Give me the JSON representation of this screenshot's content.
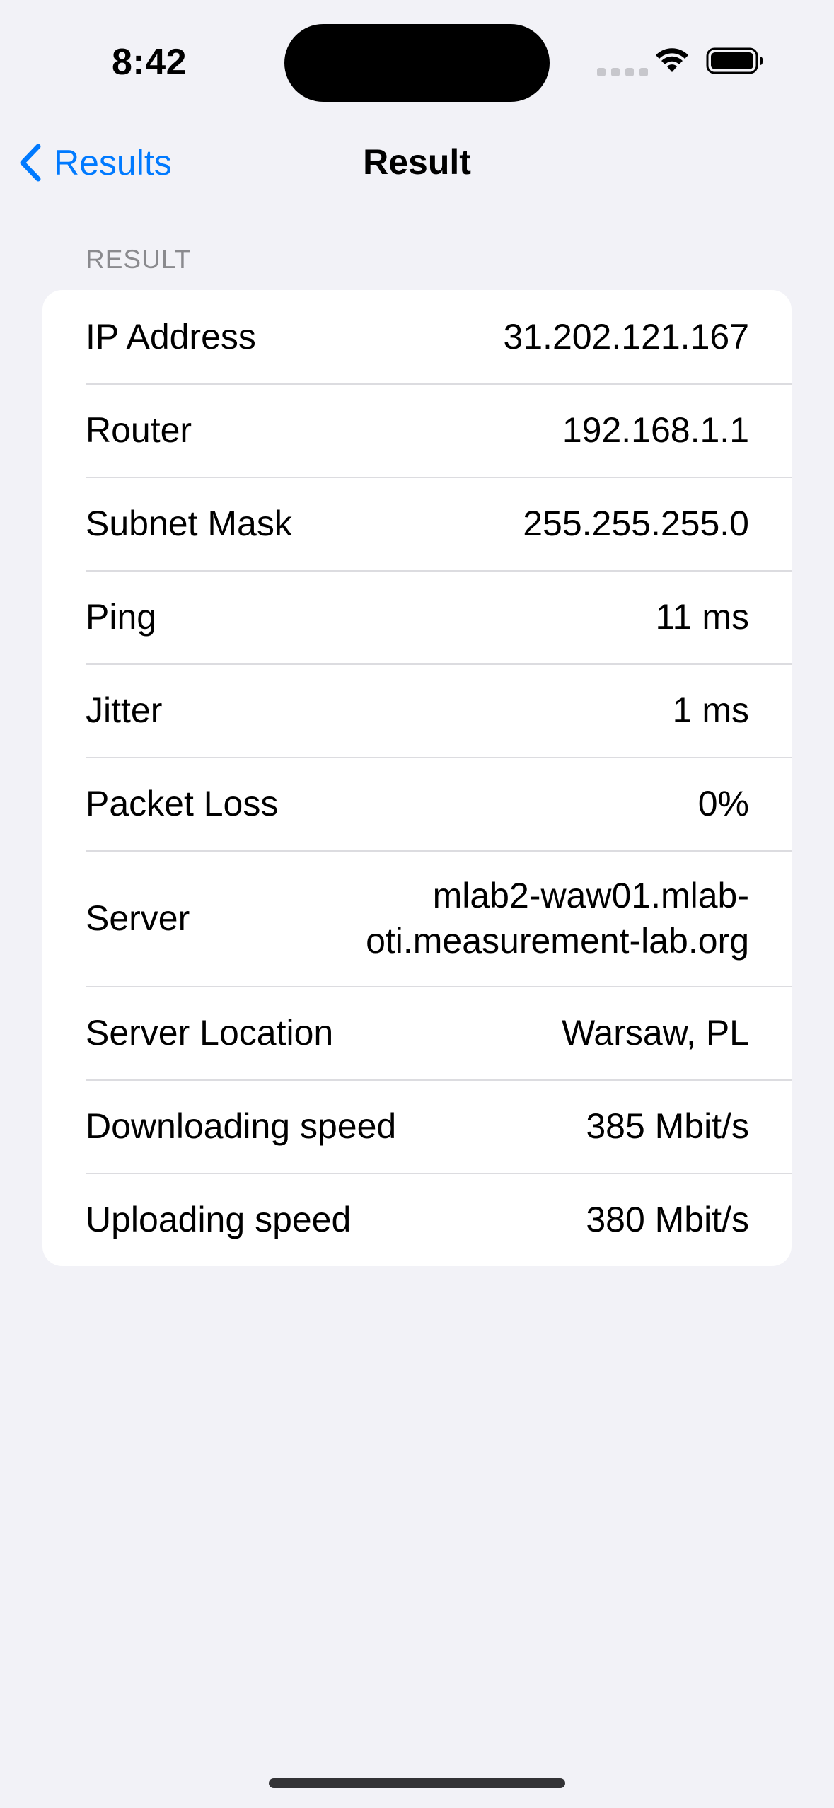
{
  "status_bar": {
    "time": "8:42"
  },
  "nav": {
    "back_label": "Results",
    "title": "Result"
  },
  "section": {
    "header": "RESULT"
  },
  "rows": [
    {
      "label": "IP Address",
      "value": "31.202.121.167"
    },
    {
      "label": "Router",
      "value": "192.168.1.1"
    },
    {
      "label": "Subnet Mask",
      "value": "255.255.255.0"
    },
    {
      "label": "Ping",
      "value": "11 ms"
    },
    {
      "label": "Jitter",
      "value": "1 ms"
    },
    {
      "label": "Packet Loss",
      "value": "0%"
    },
    {
      "label": "Server",
      "value": "mlab2-waw01.mlab-oti.measurement-lab.org"
    },
    {
      "label": "Server Location",
      "value": "Warsaw, PL"
    },
    {
      "label": "Downloading speed",
      "value": "385 Mbit/s"
    },
    {
      "label": "Uploading speed",
      "value": "380 Mbit/s"
    }
  ],
  "colors": {
    "accent": "#007AFF",
    "background": "#F2F2F7",
    "card": "#FFFFFF"
  }
}
